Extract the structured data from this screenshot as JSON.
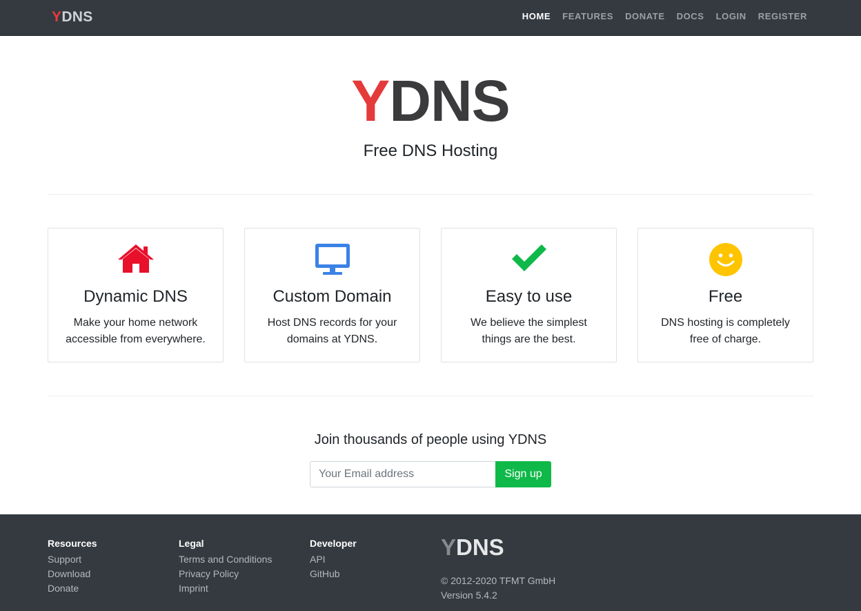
{
  "nav": {
    "brand_y": "Y",
    "brand_rest": "DNS",
    "links": [
      "HOME",
      "FEATURES",
      "DONATE",
      "DOCS",
      "LOGIN",
      "REGISTER"
    ],
    "active": "HOME"
  },
  "hero": {
    "logo_y": "Y",
    "logo_rest": "DNS",
    "tagline": "Free DNS Hosting"
  },
  "features": [
    {
      "icon": "home-icon",
      "title": "Dynamic DNS",
      "text": "Make your home network accessible from everywhere.",
      "color": "#e8102a"
    },
    {
      "icon": "monitor-icon",
      "title": "Custom Domain",
      "text": "Host DNS records for your domains at YDNS.",
      "color": "#3b82e6"
    },
    {
      "icon": "check-icon",
      "title": "Easy to use",
      "text": "We believe the simplest things are the best.",
      "color": "#0fb949"
    },
    {
      "icon": "smiley-icon",
      "title": "Free",
      "text": "DNS hosting is completely free of charge.",
      "color": "#ffc400"
    }
  ],
  "signup": {
    "heading": "Join thousands of people using YDNS",
    "placeholder": "Your Email address",
    "button": "Sign up",
    "button_color": "#0fb949"
  },
  "footer": {
    "columns": [
      {
        "title": "Resources",
        "links": [
          "Support",
          "Download",
          "Donate"
        ]
      },
      {
        "title": "Legal",
        "links": [
          "Terms and Conditions",
          "Privacy Policy",
          "Imprint"
        ]
      },
      {
        "title": "Developer",
        "links": [
          "API",
          "GitHub"
        ]
      }
    ],
    "logo_y": "Y",
    "logo_rest": "DNS",
    "copyright": "© 2012-2020 TFMT GmbH",
    "version": "Version 5.4.2"
  },
  "colors": {
    "navbar_bg": "#343a40",
    "brand_red": "#e43a3a"
  }
}
